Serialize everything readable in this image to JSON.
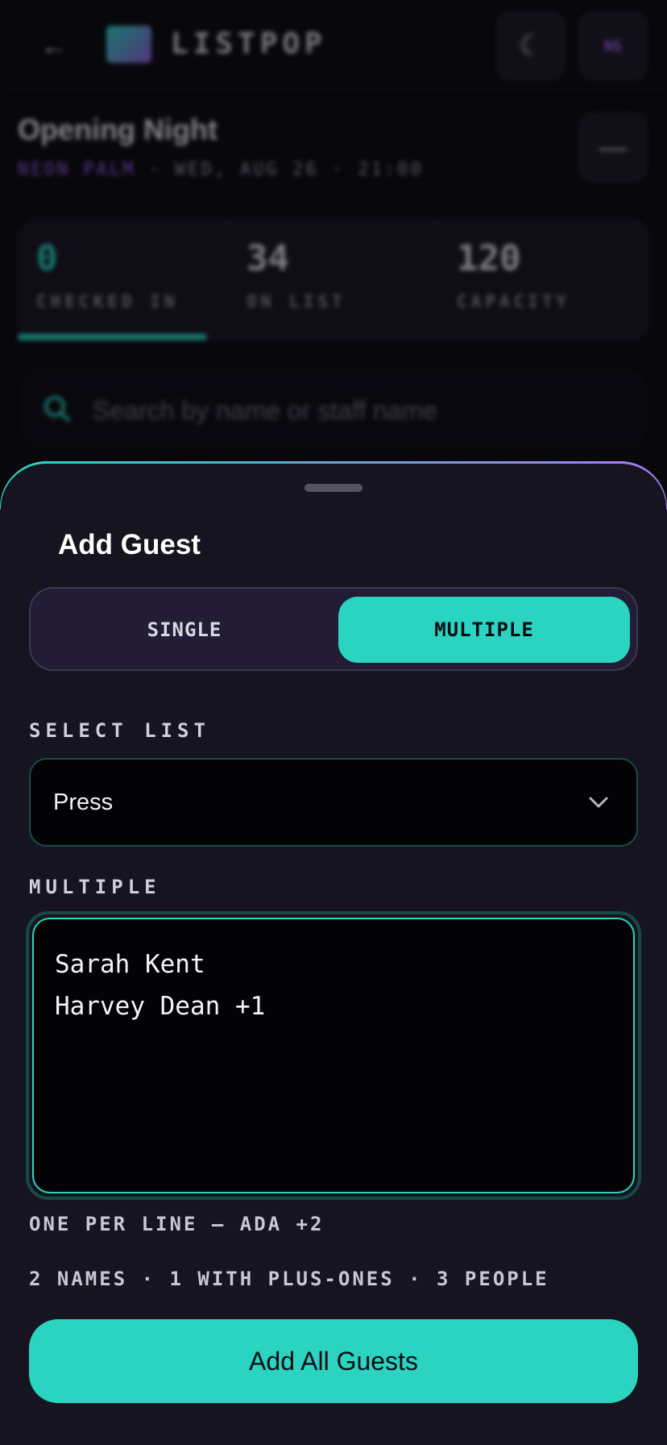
{
  "app": {
    "name": "LISTPOP",
    "avatar_initials": "NS"
  },
  "event": {
    "title": "Opening Night",
    "venue": "NEON PALM",
    "datetime": " · WED, AUG 26 · 21:00"
  },
  "stats": [
    {
      "value": "0",
      "label": "CHECKED IN"
    },
    {
      "value": "34",
      "label": "ON LIST"
    },
    {
      "value": "120",
      "label": "CAPACITY"
    }
  ],
  "checkin_progress": 0.3,
  "search": {
    "placeholder": "Search by name or staff name"
  },
  "sheet": {
    "title": "Add Guest",
    "mode_tabs": [
      {
        "label": "SINGLE",
        "selected": false
      },
      {
        "label": "MULTIPLE",
        "selected": true
      }
    ],
    "select_list_label": "SELECT LIST",
    "select_list_value": "Press",
    "multiple_label": "MULTIPLE",
    "multiple_text": "Sarah Kent\nHarvey Dean +1",
    "hint": "ONE PER LINE — ADA +2",
    "summary": "2 NAMES · 1 WITH PLUS-ONES · 3 PEOPLE",
    "submit_label": "Add All Guests"
  },
  "colors": {
    "accent": "#2ad4c0",
    "purple": "#9c5ce8",
    "sheet_bg": "#16141f"
  },
  "icons": {
    "back": "arrow-left-icon",
    "theme": "moon-icon",
    "menu": "minus-icon",
    "search": "search-icon",
    "select": "chevron-down-icon"
  }
}
